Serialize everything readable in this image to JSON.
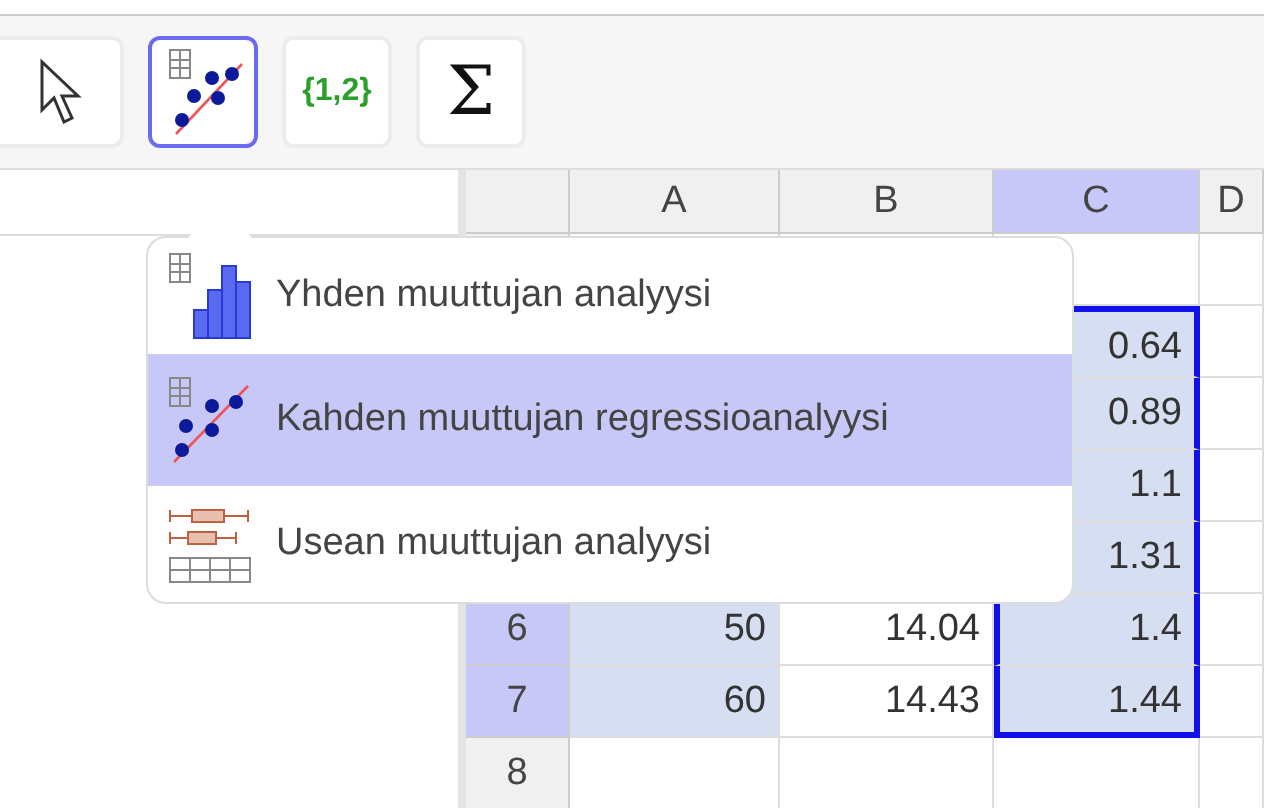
{
  "toolbar": [
    {
      "kind": "pointer",
      "selected": false
    },
    {
      "kind": "regression",
      "selected": true
    },
    {
      "kind": "list",
      "label": "{1,2}",
      "selected": false
    },
    {
      "kind": "sum",
      "label": "Σ",
      "selected": false
    }
  ],
  "menu": [
    {
      "kind": "histogram",
      "label": "Yhden muuttujan analyysi",
      "selected": false
    },
    {
      "kind": "scatter",
      "label": "Kahden muuttujan regressioanalyysi",
      "selected": true
    },
    {
      "kind": "boxplot",
      "label": "Usean muuttujan analyysi",
      "selected": false
    }
  ],
  "sheet": {
    "columns": [
      {
        "label": "A",
        "selected": false
      },
      {
        "label": "B",
        "selected": false
      },
      {
        "label": "C",
        "selected": true
      },
      {
        "label": "D",
        "selected": false
      }
    ],
    "rows": [
      {
        "cells": [
          {},
          {},
          {
            "selected": false
          }
        ]
      },
      {
        "cells": [
          {},
          {},
          {
            "text": "0.64",
            "selected": true
          }
        ]
      },
      {
        "cells": [
          {},
          {},
          {
            "text": "0.89",
            "selected": true
          }
        ]
      },
      {
        "cells": [
          {},
          {},
          {
            "text": "1.1",
            "selected": true
          }
        ]
      },
      {
        "cells": [
          {},
          {},
          {
            "text": "1.31",
            "selected": true
          }
        ]
      },
      {
        "label": "6",
        "selected": true,
        "cells": [
          {
            "text": "50",
            "selected": true
          },
          {
            "text": "14.04",
            "selected": false
          },
          {
            "text": "1.4",
            "selected": true
          }
        ]
      },
      {
        "label": "7",
        "selected": true,
        "cells": [
          {
            "text": "60",
            "selected": true
          },
          {
            "text": "14.43",
            "selected": false
          },
          {
            "text": "1.44",
            "selected": true
          }
        ]
      },
      {
        "label": "8",
        "selected": false,
        "cells": [
          {
            "selected": false
          },
          {
            "selected": false
          },
          {
            "selected": false
          }
        ]
      }
    ]
  }
}
